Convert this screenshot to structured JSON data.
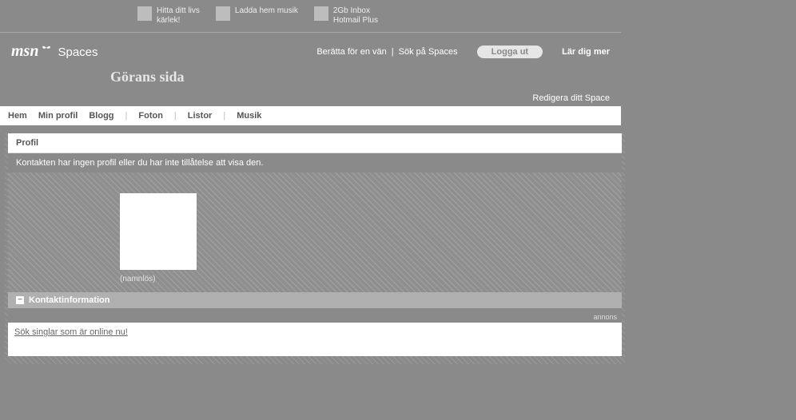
{
  "promo": [
    {
      "line1": "Hitta ditt livs",
      "line2": "kärlek!"
    },
    {
      "line1": "Ladda hem musik",
      "line2": ""
    },
    {
      "line1": "2Gb Inbox",
      "line2": "Hotmail Plus"
    }
  ],
  "logo": {
    "msn": "msn",
    "spaces": "Spaces"
  },
  "header": {
    "tell_friend": "Berätta för en vän",
    "search": "Sök på Spaces",
    "logout": "Logga ut",
    "learn_more": "Lär dig mer",
    "separator": "|"
  },
  "space_title": "Görans sida",
  "edit_space": "Redigera ditt Space",
  "nav": {
    "home": "Hem",
    "profile": "Min profil",
    "blog": "Blogg",
    "photos": "Foton",
    "lists": "Listor",
    "music": "Musik",
    "sep": "|"
  },
  "profile_panel": {
    "title": "Profil",
    "message": "Kontakten har ingen profil eller du har inte tillåtelse att visa den.",
    "avatar_caption": "(namnlös)"
  },
  "contact_panel": {
    "title": "Kontaktinformation",
    "collapse_glyph": "−"
  },
  "ad": {
    "label": "annons",
    "link_text": "Sök singlar som är online nu!"
  }
}
